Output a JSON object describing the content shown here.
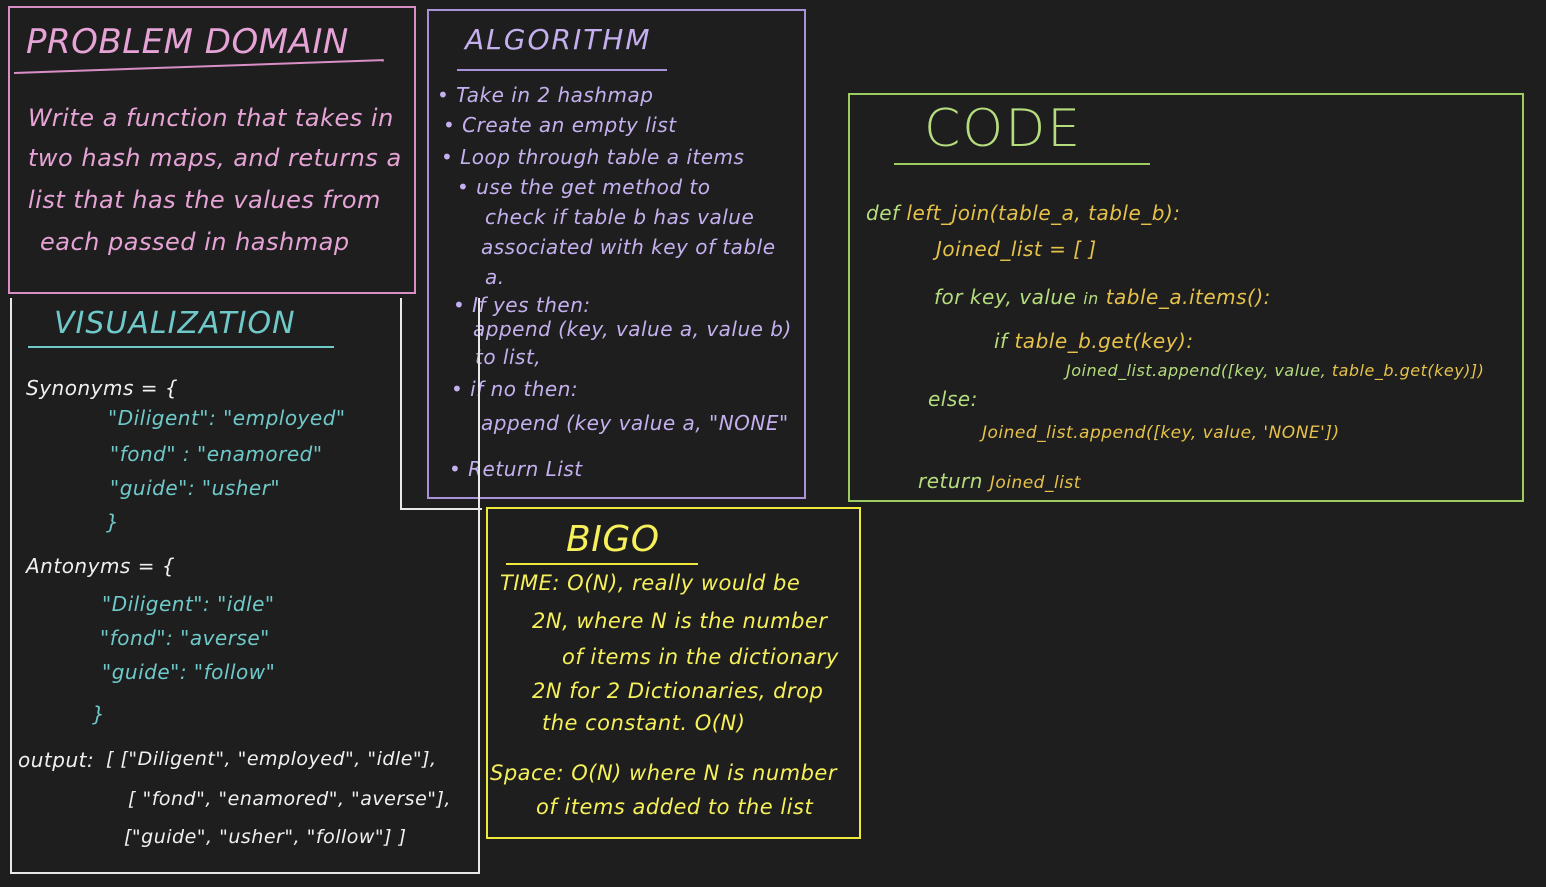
{
  "problem_domain": {
    "title": "PROBLEM DOMAIN",
    "lines": [
      "Write a function that takes in",
      "two hash maps, and returns a",
      "list that has the values from",
      "each passed in hashmap"
    ],
    "color": "#e6a3d6"
  },
  "algorithm": {
    "title": "ALGORITHM",
    "lines": [
      "• Take in 2 hashmap",
      "• Create an empty list",
      "• Loop through table a items",
      "• use the get method to",
      "check if table b has value",
      "associated with key of table",
      "a.",
      "• If yes then:",
      "append (key, value a, value b)",
      "to list,",
      "• if no then:",
      "append (key value a, \"NONE\"",
      "• Return List"
    ],
    "color": "#c4b0ee"
  },
  "code": {
    "title": "CODE",
    "l1_kw": "def",
    "l1_rest": "left_join(table_a, table_b):",
    "l2": "Joined_list = [ ]",
    "l3_kw": "for",
    "l3_a": "key, value",
    "l3_in": "in",
    "l3_b": "table_a.items():",
    "l4_kw": "if",
    "l4_rest": "table_b.get(key):",
    "l5_a": "Joined_list.append([key, value,",
    "l5_b": "table_b.get(key)])",
    "l6": "else:",
    "l7": "Joined_list.append([key, value, 'NONE'])",
    "l8_kw": "return",
    "l8_rest": "Joined_list",
    "color": "#b5dd7e",
    "accent": "#e6c24a"
  },
  "visualization": {
    "title": "VISUALIZATION",
    "syn_label": "Synonyms = {",
    "syn_items": [
      "\"Diligent\": \"employed\"",
      "\"fond\" : \"enamored\"",
      "\"guide\": \"usher\""
    ],
    "close1": "}",
    "ant_label": "Antonyms = {",
    "ant_items": [
      "\"Diligent\": \"idle\"",
      "\"fond\": \"averse\"",
      "\"guide\": \"follow\""
    ],
    "close2": "}",
    "output_label": "output:",
    "output_lines": [
      "[ [\"Diligent\", \"employed\", \"idle\"],",
      "[ \"fond\", \"enamored\", \"averse\"],",
      "[\"guide\", \"usher\", \"follow\"] ]"
    ],
    "color": "#6fc9c9"
  },
  "big_o": {
    "title": "BIGO",
    "lines": [
      "TIME: O(N), really would be",
      "2N, where N is the number",
      "of items in the dictionary",
      "2N for 2 Dictionaries, drop",
      "the constant. O(N)",
      "Space: O(N) where N is number",
      "of items added to the list"
    ],
    "color": "#f6f05a"
  }
}
